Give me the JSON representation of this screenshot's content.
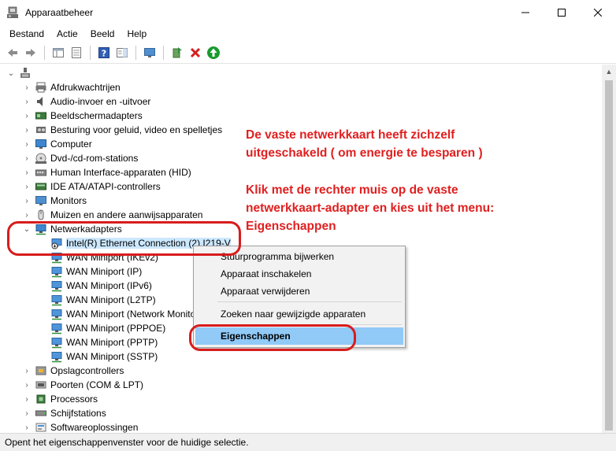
{
  "window": {
    "title": "Apparaatbeheer",
    "minimize_glyph": "—",
    "maximize_glyph": "☐",
    "close_glyph": "✕"
  },
  "menu": [
    "Bestand",
    "Actie",
    "Beeld",
    "Help"
  ],
  "toolbar": {
    "icons": [
      "back-icon",
      "forward-icon",
      "properties-view-icon",
      "hidden-devices-icon",
      "help-icon",
      "action-pane-icon",
      "monitor-icon",
      "update-driver-icon",
      "uninstall-icon",
      "enable-device-icon"
    ],
    "accent_delete": "#d42020",
    "accent_enable": "#1a9a2e"
  },
  "tree": {
    "categories_top": [
      {
        "label": "Afdrukwachtrijen",
        "icon": "printer-icon"
      },
      {
        "label": "Audio-invoer en -uitvoer",
        "icon": "speaker-icon"
      },
      {
        "label": "Beeldschermadapters",
        "icon": "display-adapter-icon"
      },
      {
        "label": "Besturing voor geluid, video en spelletjes",
        "icon": "sound-icon"
      },
      {
        "label": "Computer",
        "icon": "computer-icon"
      },
      {
        "label": "Dvd-/cd-rom-stations",
        "icon": "dvd-icon"
      },
      {
        "label": "Human Interface-apparaten (HID)",
        "icon": "hid-icon"
      },
      {
        "label": "IDE ATA/ATAPI-controllers",
        "icon": "ide-icon"
      },
      {
        "label": "Monitors",
        "icon": "monitor-icon"
      },
      {
        "label": "Muizen en andere aanwijsapparaten",
        "icon": "mouse-icon"
      }
    ],
    "expanded": {
      "label": "Netwerkadapters",
      "icon": "network-icon"
    },
    "children": [
      "Intel(R) Ethernet Connection (2) I219-V",
      "WAN Miniport (IKEv2)",
      "WAN Miniport (IP)",
      "WAN Miniport (IPv6)",
      "WAN Miniport (L2TP)",
      "WAN Miniport (Network Monitor)",
      "WAN Miniport (PPPOE)",
      "WAN Miniport (PPTP)",
      "WAN Miniport (SSTP)"
    ],
    "categories_bottom": [
      {
        "label": "Opslagcontrollers",
        "icon": "storage-icon"
      },
      {
        "label": "Poorten (COM & LPT)",
        "icon": "port-icon"
      },
      {
        "label": "Processors",
        "icon": "processor-icon"
      },
      {
        "label": "Schijfstations",
        "icon": "disk-icon"
      },
      {
        "label": "Softwareoplossingen",
        "icon": "software-icon"
      }
    ]
  },
  "context_menu": {
    "items": [
      "Stuurprogramma bijwerken",
      "Apparaat inschakelen",
      "Apparaat verwijderen"
    ],
    "scan": "Zoeken naar gewijzigde apparaten",
    "properties": "Eigenschappen"
  },
  "annotation": {
    "line1": "De vaste netwerkkaart heeft zichzelf",
    "line2": "uitgeschakeld ( om energie te besparen )",
    "line3": "Klik met de rechter muis op de vaste",
    "line4": "netwerkkaart-adapter en kies uit het menu:",
    "line5": "Eigenschappen",
    "color": "#e02020"
  },
  "status": "Opent het eigenschappenvenster voor de huidige selectie."
}
